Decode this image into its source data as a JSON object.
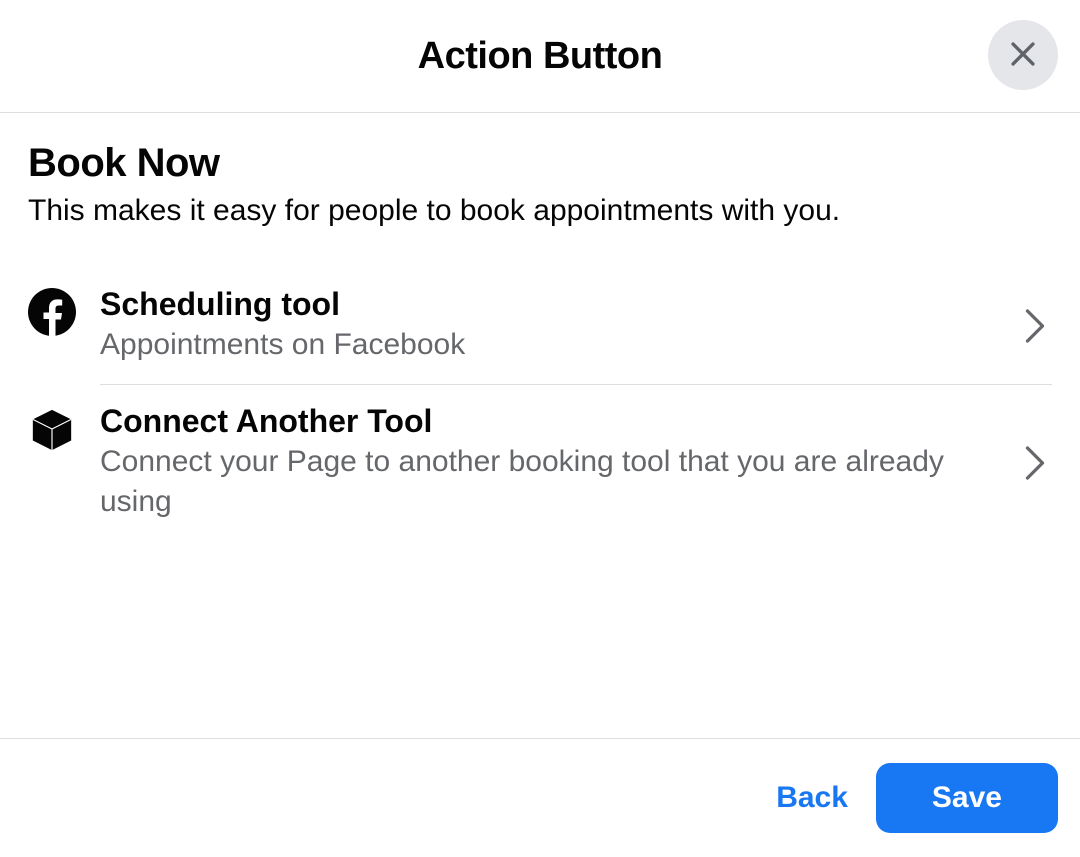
{
  "header": {
    "title": "Action Button"
  },
  "section": {
    "title": "Book Now",
    "subtitle": "This makes it easy for people to book appointments with you."
  },
  "options": [
    {
      "title": "Scheduling tool",
      "desc": "Appointments on Facebook"
    },
    {
      "title": "Connect Another Tool",
      "desc": "Connect your Page to another booking tool that you are already using"
    }
  ],
  "footer": {
    "back": "Back",
    "save": "Save"
  }
}
